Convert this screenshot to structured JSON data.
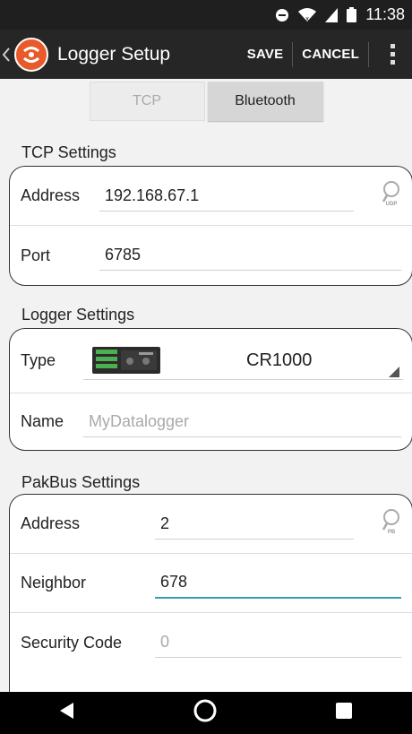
{
  "status_bar": {
    "time": "11:38",
    "icons": [
      "do-not-disturb-icon",
      "wifi-icon",
      "signal-icon",
      "battery-icon"
    ],
    "battery_label": "84"
  },
  "action_bar": {
    "title": "Logger Setup",
    "save_label": "SAVE",
    "cancel_label": "CANCEL",
    "bg_color": "#262626",
    "logo_color": "#e85a2a"
  },
  "connection_toggle": {
    "tcp_label": "TCP",
    "bluetooth_label": "Bluetooth",
    "selected": "Bluetooth"
  },
  "tcp_settings": {
    "header": "TCP Settings",
    "address_label": "Address",
    "address_value": "192.168.67.1",
    "address_lookup_caption": "UDP",
    "port_label": "Port",
    "port_value": "6785"
  },
  "logger_settings": {
    "header": "Logger Settings",
    "type_label": "Type",
    "type_value": "CR1000",
    "name_label": "Name",
    "name_placeholder": "MyDatalogger"
  },
  "pakbus_settings": {
    "header": "PakBus Settings",
    "address_label": "Address",
    "address_value": "2",
    "address_lookup_caption": "PB",
    "neighbor_label": "Neighbor",
    "neighbor_value": "678",
    "security_label": "Security Code",
    "security_placeholder": "0",
    "focus_color": "#3a9bb0"
  },
  "nav_bar": {
    "buttons": [
      "back-icon",
      "home-icon",
      "recents-icon"
    ]
  }
}
